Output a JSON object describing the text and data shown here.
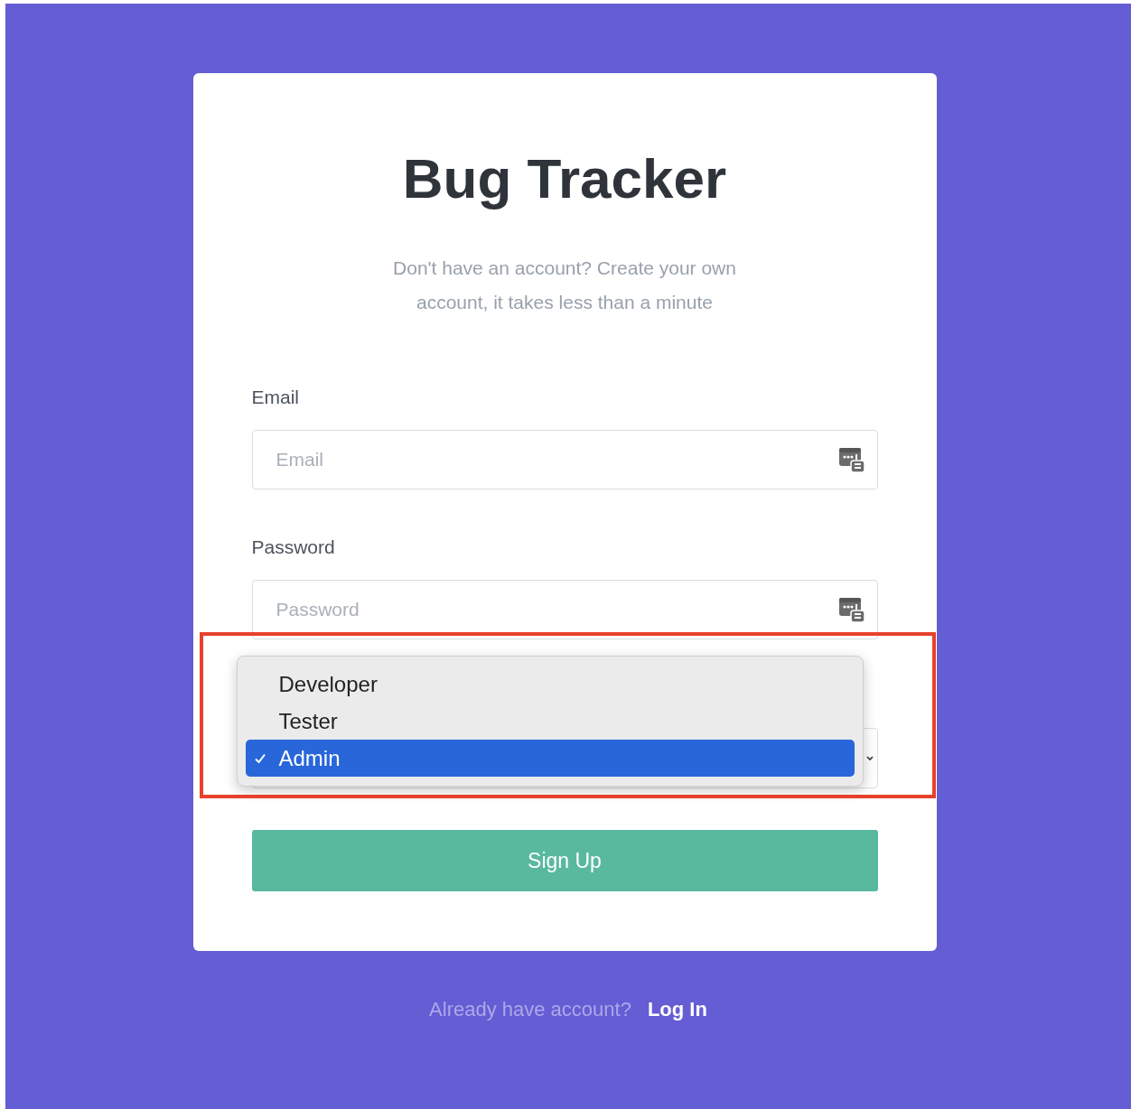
{
  "title": "Bug Tracker",
  "subtitle": "Don't have an account? Create your own account, it takes less than a minute",
  "fields": [
    {
      "label": "Email",
      "placeholder": "Email"
    },
    {
      "label": "Password",
      "placeholder": "Password"
    }
  ],
  "role_select": {
    "options": [
      {
        "label": "Developer",
        "selected": false
      },
      {
        "label": "Tester",
        "selected": false
      },
      {
        "label": "Admin",
        "selected": true
      }
    ]
  },
  "submit_button": "Sign Up",
  "footer": {
    "text": "Already have account?",
    "link": "Log In"
  }
}
